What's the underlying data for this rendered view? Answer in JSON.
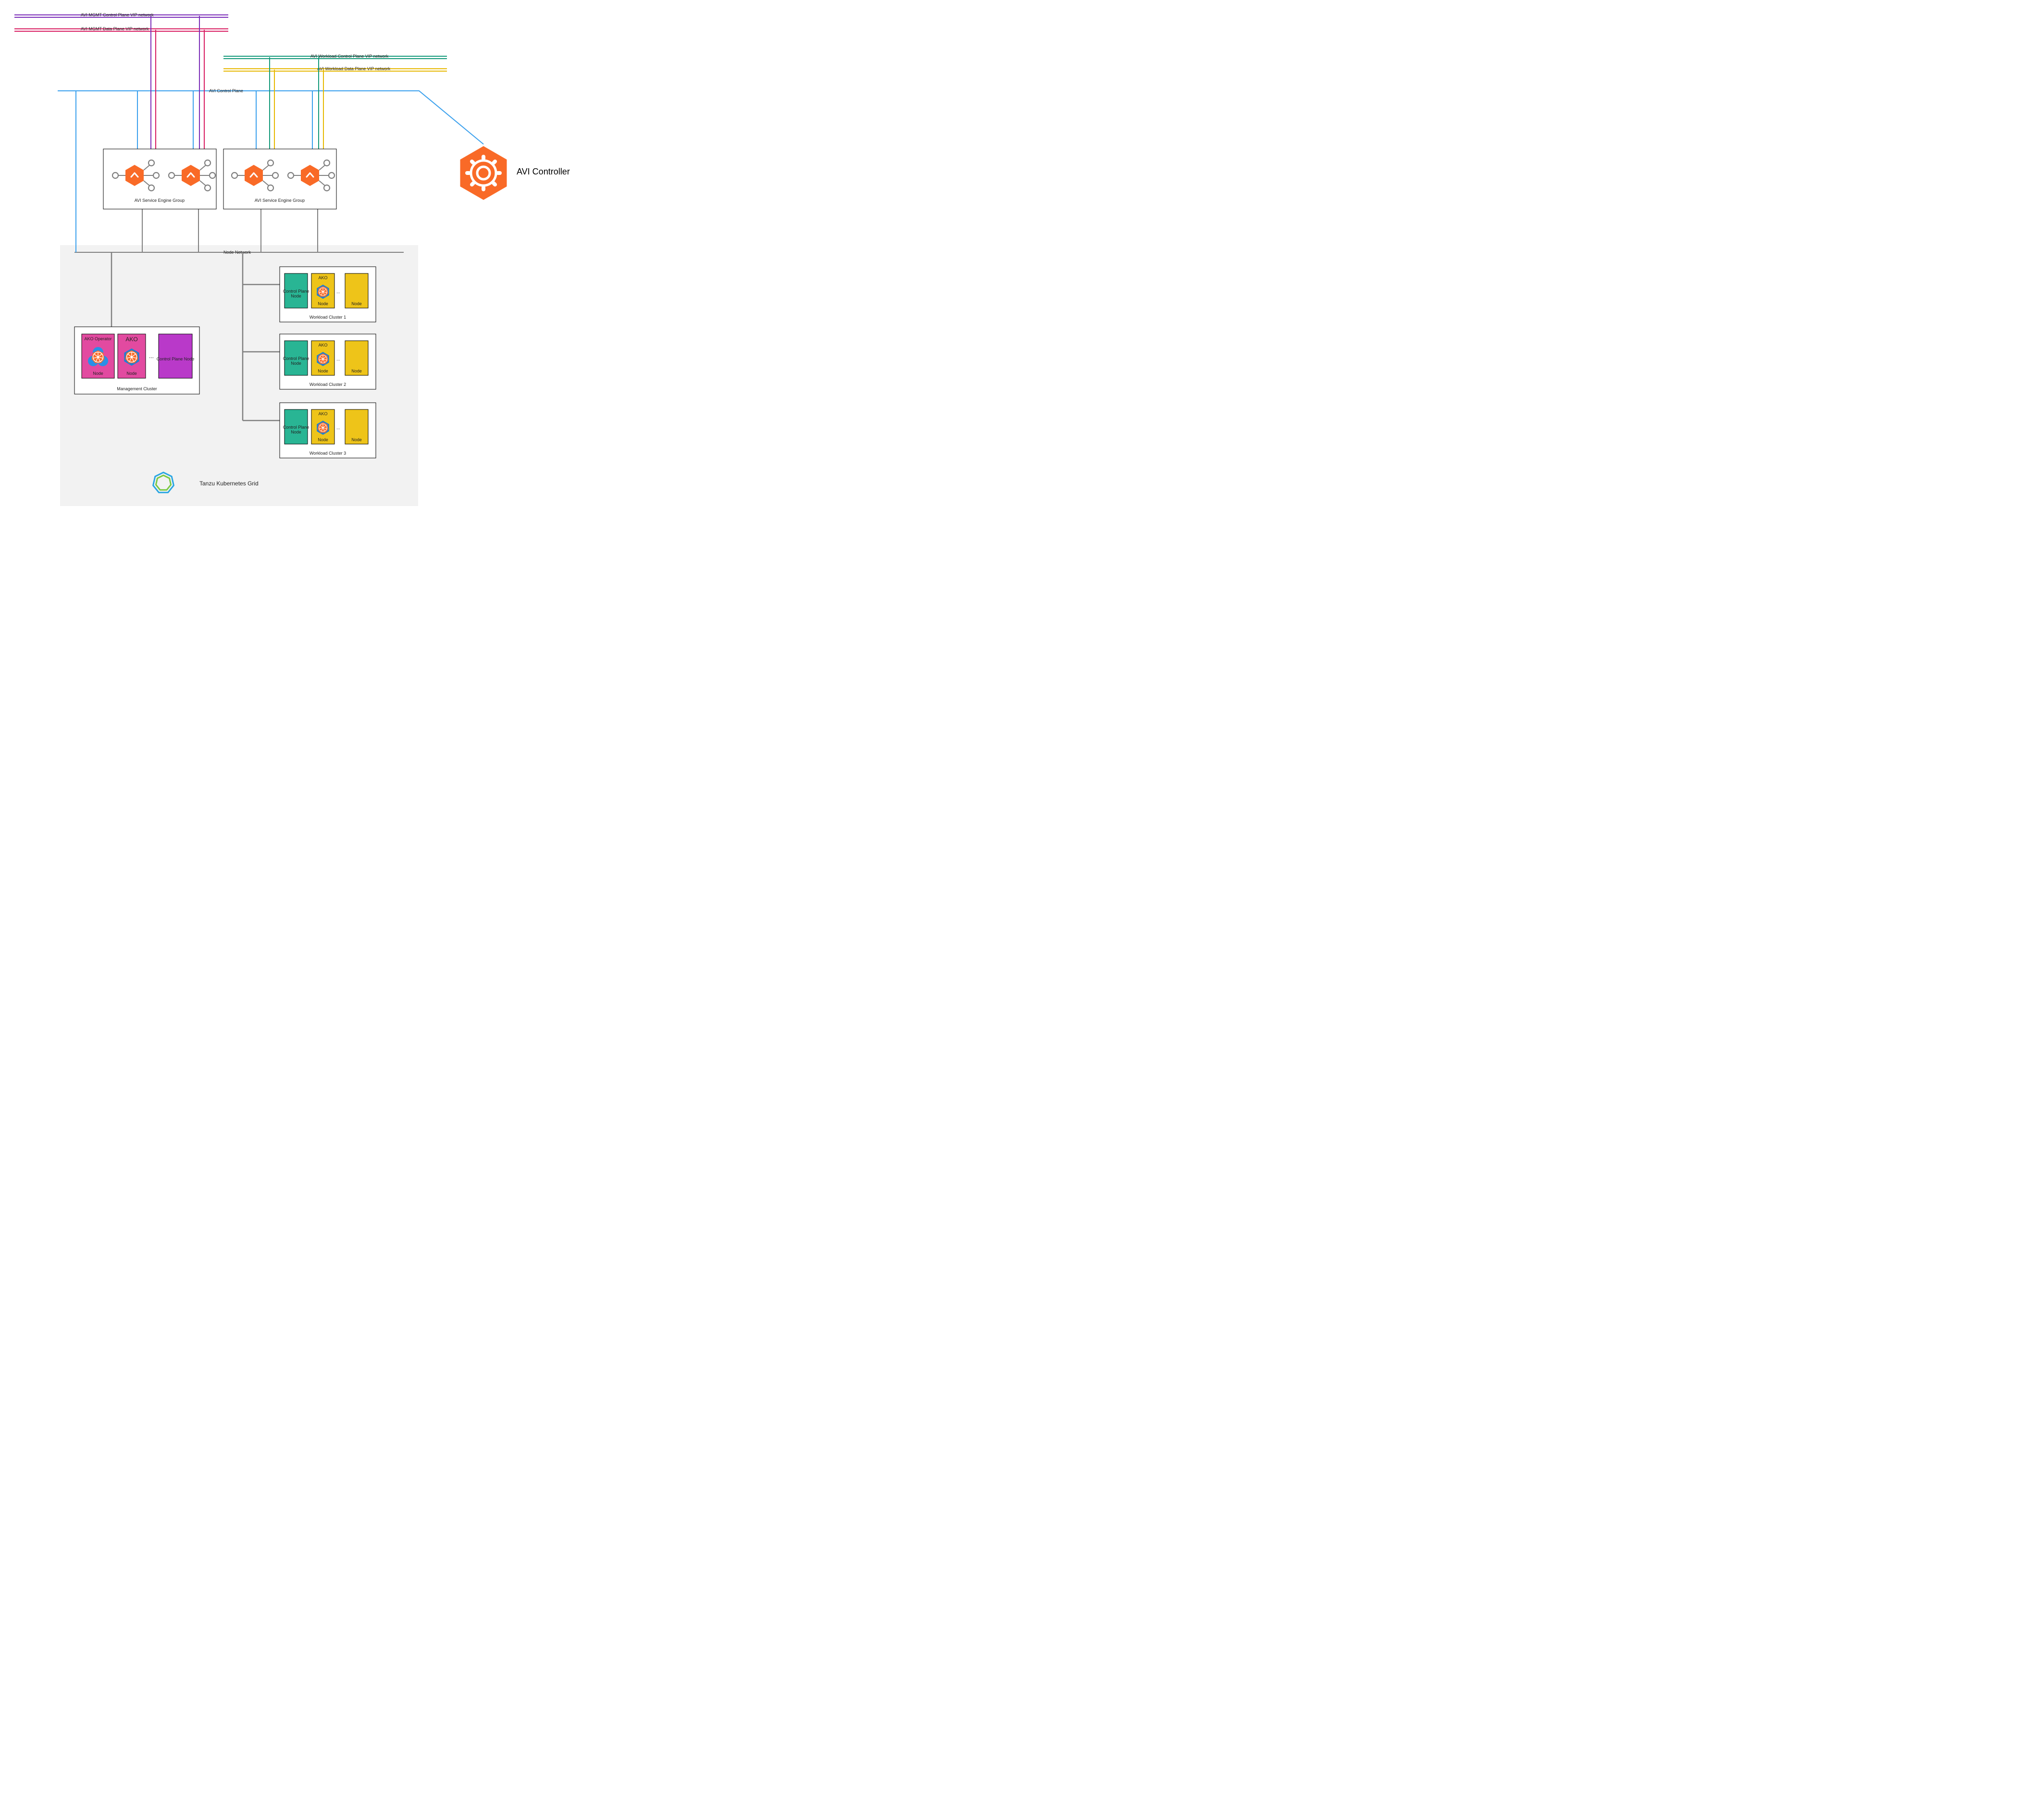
{
  "networks": {
    "mgmt_cp": {
      "label": "AVI MGMT Control Plane VIP network",
      "color": "#7a2db8"
    },
    "mgmt_dp": {
      "label": "AVI MGMT Data Plane VIP network",
      "color": "#d81b60"
    },
    "wl_cp": {
      "label": "AVI Workload Control Plane VIP network",
      "color": "#149a7a"
    },
    "wl_dp": {
      "label": "AVI Workload Data Plane VIP network",
      "color": "#e6b800"
    },
    "ctrl": {
      "label": "AVI Control Plane",
      "color": "#3aa0ed"
    },
    "node": {
      "label": "Node Network",
      "color": "#808080"
    }
  },
  "se_group": {
    "label": "AVI Service Engine Group",
    "groups": [
      {
        "id": "segA"
      },
      {
        "id": "segB"
      }
    ]
  },
  "avi_controller": {
    "label": "AVI Controller"
  },
  "tanzu": {
    "label": "Tanzu Kubernetes Grid"
  },
  "mgmt_cluster": {
    "label": "Management Cluster",
    "nodes": [
      {
        "kind": "ako-operator",
        "title": "AKO Operator",
        "sub": "Node",
        "fill": "#e24aa0"
      },
      {
        "kind": "ako",
        "title": "AKO",
        "sub": "Node",
        "fill": "#e24aa0"
      },
      {
        "kind": "ellipsis"
      },
      {
        "kind": "cp",
        "title": "Control Plane Node",
        "fill": "#b939c9"
      }
    ]
  },
  "workload_clusters": [
    {
      "label": "Workload Cluster 1"
    },
    {
      "label": "Workload Cluster 2"
    },
    {
      "label": "Workload Cluster 3"
    }
  ],
  "workload_nodes": {
    "cp": {
      "title": "Control Plane Node",
      "fill": "#29b594"
    },
    "ako": {
      "title": "AKO",
      "sub": "Node",
      "fill": "#eec419"
    },
    "plain": {
      "title": "Node",
      "fill": "#eec419"
    },
    "ellipsis": "..."
  },
  "colors": {
    "orange": "#f96a27",
    "grey": "#808080",
    "box": "#000000",
    "panel": "#f2f2f2"
  }
}
